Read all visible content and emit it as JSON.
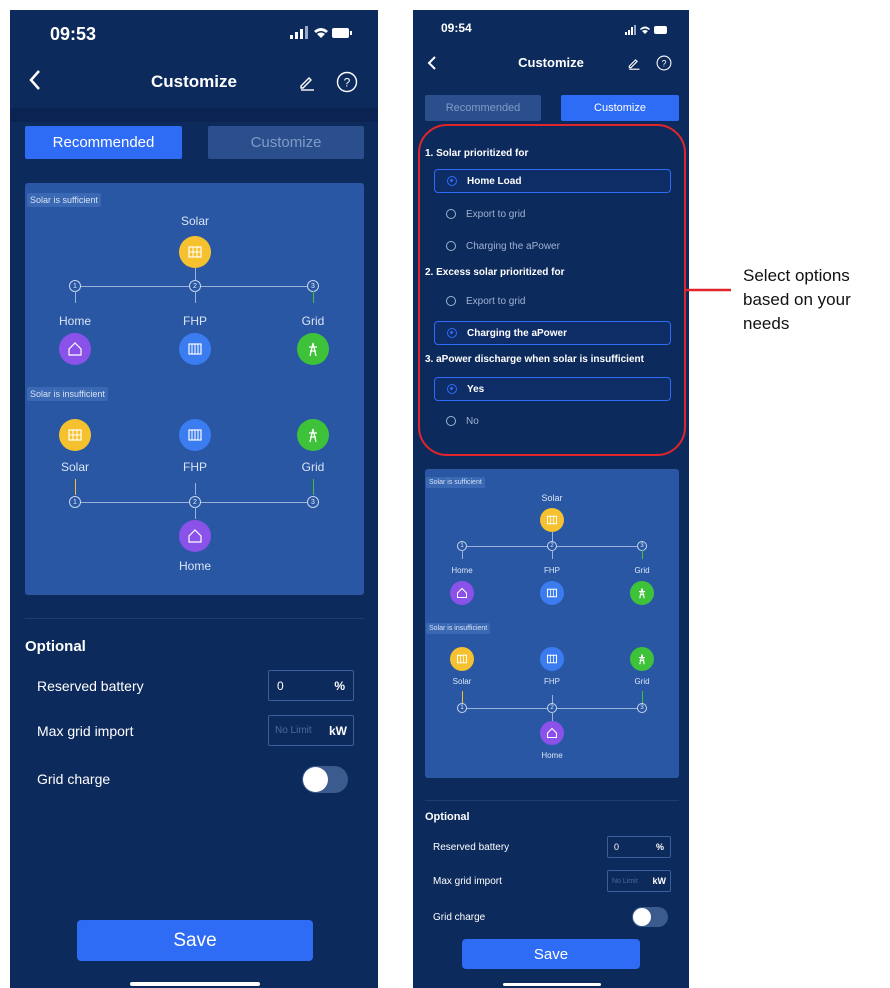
{
  "left": {
    "status_time": "09:53",
    "title": "Customize",
    "tabs": [
      "Recommended",
      "Customize"
    ],
    "sufficient_tag": "Solar is sufficient",
    "insufficient_tag": "Solar is insufficient",
    "labels": {
      "solar": "Solar",
      "home": "Home",
      "fhp": "FHP",
      "grid": "Grid"
    },
    "nodes": [
      "1",
      "2",
      "3"
    ],
    "optional_title": "Optional",
    "reserved_battery_label": "Reserved battery",
    "reserved_battery_value": "0",
    "reserved_battery_unit": "%",
    "max_grid_import_label": "Max grid import",
    "max_grid_import_placeholder": "No Limit",
    "max_grid_import_unit": "kW",
    "grid_charge_label": "Grid charge",
    "grid_charge_on": false,
    "save_label": "Save"
  },
  "right": {
    "status_time": "09:54",
    "title": "Customize",
    "tabs": [
      "Recommended",
      "Customize"
    ],
    "q1": "1. Solar prioritized for",
    "q1_options": [
      "Home Load",
      "Export to grid",
      "Charging the aPower"
    ],
    "q2": "2. Excess solar prioritized for",
    "q2_options": [
      "Export to grid",
      "Charging the aPower"
    ],
    "q3": "3. aPower discharge when solar is insufficient",
    "q3_options": [
      "Yes",
      "No"
    ],
    "sufficient_tag": "Solar is sufficient",
    "insufficient_tag": "Solar is insufficient",
    "labels": {
      "solar": "Solar",
      "home": "Home",
      "fhp": "FHP",
      "grid": "Grid"
    },
    "nodes": [
      "1",
      "2",
      "3"
    ],
    "optional_title": "Optional",
    "reserved_battery_label": "Reserved battery",
    "reserved_battery_value": "0",
    "reserved_battery_unit": "%",
    "max_grid_import_label": "Max grid import",
    "max_grid_import_placeholder": "No Limit",
    "max_grid_import_unit": "kW",
    "grid_charge_label": "Grid charge",
    "save_label": "Save"
  },
  "annotation": {
    "text_lines": [
      "Select options",
      "based on your",
      "needs"
    ],
    "color": "#e0262b"
  },
  "colors": {
    "background": "#0d2a5c",
    "accent": "#2f6cf5",
    "solar": "#f5c12e",
    "fhp": "#3b7cf0",
    "grid": "#3ec23a",
    "home": "#8a52e8"
  }
}
